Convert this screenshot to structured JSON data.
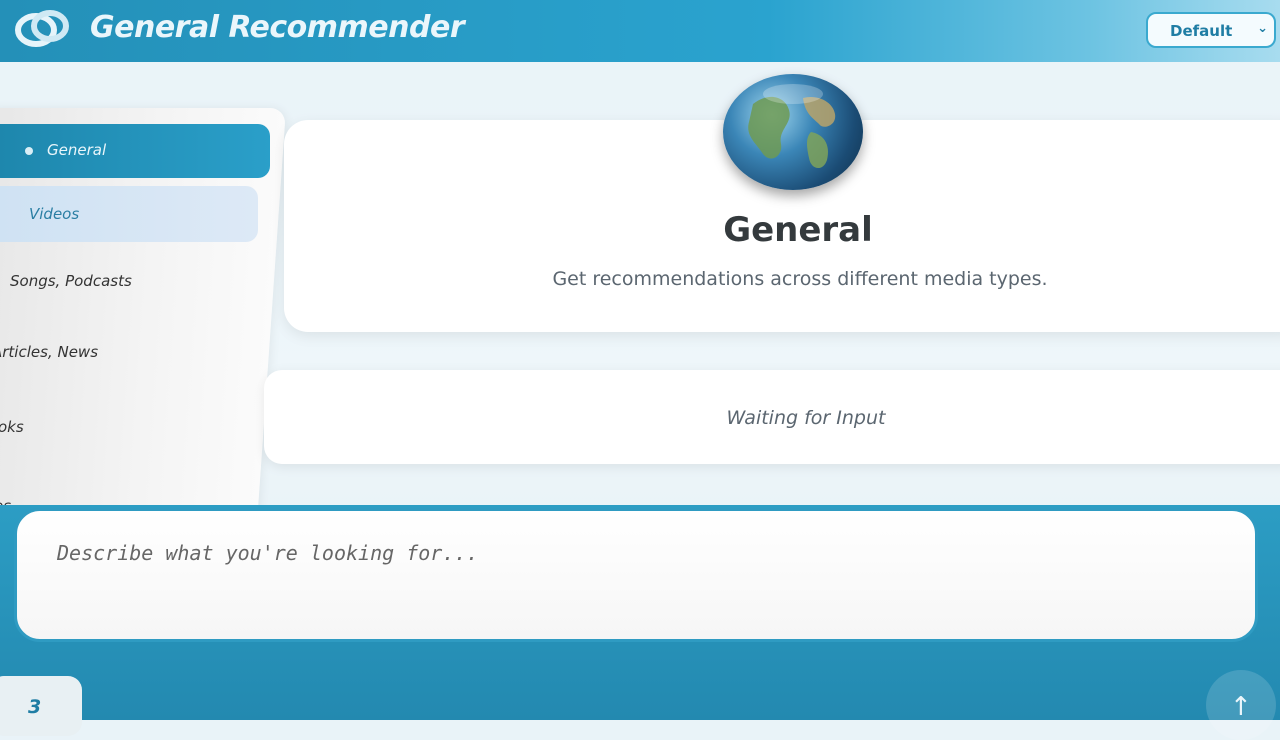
{
  "header": {
    "app_title": "General Recommender",
    "theme_select": {
      "value": "Default",
      "icon": "chevron-down-icon"
    }
  },
  "sidebar": {
    "items": [
      {
        "label": "General",
        "active": true
      },
      {
        "label": "Videos"
      },
      {
        "label": "Songs, Podcasts"
      },
      {
        "label": "Articles, News"
      },
      {
        "label": "oks"
      },
      {
        "label": "es"
      }
    ]
  },
  "main": {
    "title": "General",
    "subtitle": "Get recommendations across different media types.",
    "icon": "globe-icon",
    "status": "Waiting for Input"
  },
  "composer": {
    "placeholder": "Describe what you're looking for...",
    "count": "3",
    "send_icon": "arrow-up-icon"
  },
  "colors": {
    "accent": "#2a9fc9",
    "header_bg": "#2490b8",
    "text_muted": "#5b6670"
  }
}
